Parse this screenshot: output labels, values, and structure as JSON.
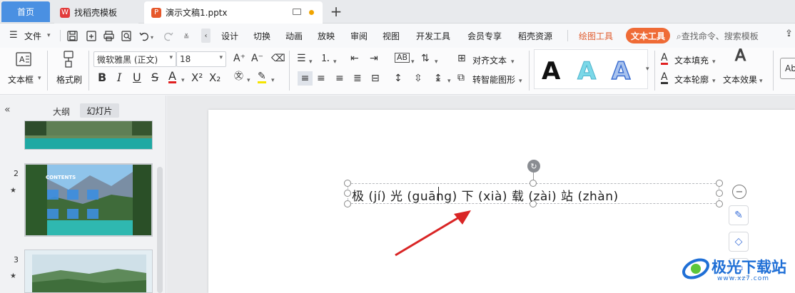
{
  "tabs": {
    "home": "首页",
    "template": "找稻壳模板",
    "document": "演示文稿1.pptx",
    "add": "+"
  },
  "menubar": {
    "file_label": "文件",
    "items": [
      "设计",
      "切换",
      "动画",
      "放映",
      "审阅",
      "视图",
      "开发工具",
      "会员专享",
      "稻壳资源",
      "绘图工具"
    ],
    "active_tab": "文本工具",
    "search_placeholder": "查找命令、搜索模板"
  },
  "ribbon": {
    "textbox_label": "文本框",
    "format_painter_label": "格式刷",
    "font_name": "微软雅黑 (正文)",
    "font_size": "18",
    "align_text_label": "对齐文本",
    "smart_shape_label": "转智能图形",
    "text_fill_label": "文本填充",
    "text_outline_label": "文本轮廓",
    "text_effect_label": "文本效果",
    "wordart_letter": "A",
    "font_color": "#e02020",
    "highlight_color": "#f5e400",
    "partial_right": "Ab"
  },
  "left_panel": {
    "outline_tab": "大纲",
    "slides_tab": "幻灯片",
    "slides": [
      {
        "number": "",
        "title": ""
      },
      {
        "number": "2",
        "title": "CONTENTS"
      },
      {
        "number": "3",
        "title": ""
      }
    ],
    "star": "★"
  },
  "slide": {
    "text": "极 (jí) 光 (guāng) 下 (xià) 载 (zài) 站 (zhàn)"
  },
  "watermark": {
    "text": "极光下载站",
    "url": "www.xz7.com"
  },
  "colors": {
    "accent_blue": "#4a90e2",
    "accent_orange": "#ef6b36",
    "arrow_red": "#d92525"
  }
}
